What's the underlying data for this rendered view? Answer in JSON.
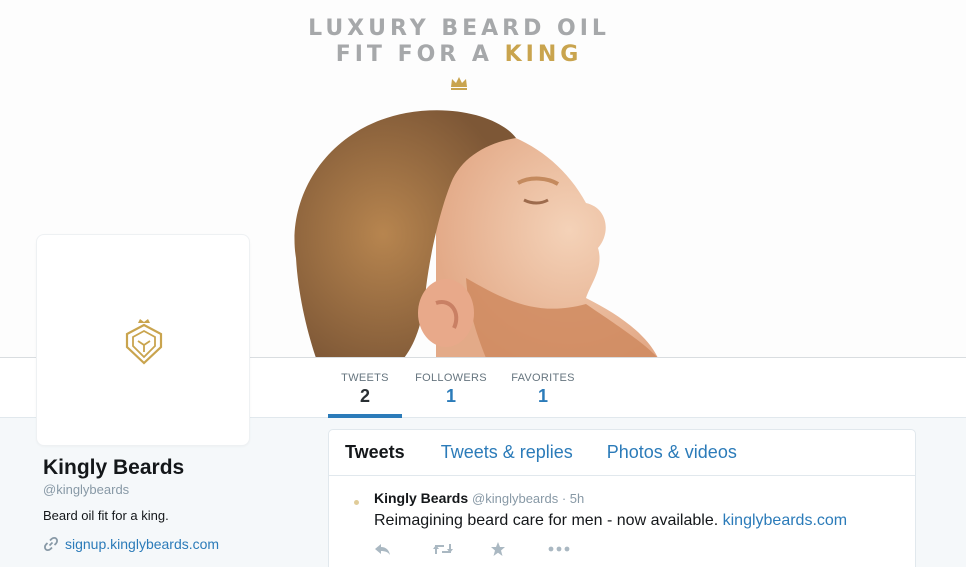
{
  "banner": {
    "line1": "LUXURY BEARD OIL",
    "line2_prefix": "FIT FOR A ",
    "line2_highlight": "KING",
    "crown_icon": "crown-icon",
    "colors": {
      "gray": "#a6a8aa",
      "gold": "#c9a44e"
    }
  },
  "stats": {
    "tweets": {
      "label": "TWEETS",
      "value": "2"
    },
    "followers": {
      "label": "FOLLOWERS",
      "value": "1"
    },
    "favorites": {
      "label": "FAVORITES",
      "value": "1"
    }
  },
  "profile": {
    "name": "Kingly Beards",
    "handle": "@kinglybeards",
    "bio": "Beard oil fit for a king.",
    "link": "signup.kinglybeards.com",
    "link_icon": "link-icon",
    "avatar_icon": "lion-crest-icon"
  },
  "timeline": {
    "tabs": [
      "Tweets",
      "Tweets & replies",
      "Photos & videos"
    ],
    "tweet": {
      "author": "Kingly Beards",
      "handle": "@kinglybeards",
      "separator": " · ",
      "time": "5h",
      "text": "Reimagining beard care for men - now available. ",
      "link": "kinglybeards.com",
      "actions": [
        "reply-icon",
        "retweet-icon",
        "favorite-icon",
        "more-icon"
      ]
    }
  },
  "colors": {
    "accent": "#2b7bb9",
    "gold": "#c9a44e",
    "background": "#f5f8fa"
  }
}
